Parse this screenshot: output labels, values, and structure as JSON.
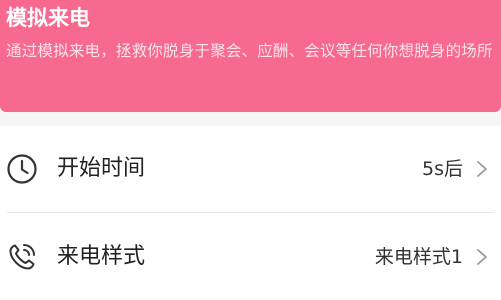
{
  "header": {
    "title": "模拟来电",
    "description": "通过模拟来电，拯救你脱身于聚会、应酬、会议等任何你想脱身的场所"
  },
  "settings": [
    {
      "label": "开始时间",
      "value": "5s后",
      "icon": "clock-icon"
    },
    {
      "label": "来电样式",
      "value": "来电样式1",
      "icon": "phone-icon"
    }
  ],
  "colors": {
    "banner": "#f7698f",
    "background": "#ffffff",
    "separator": "#f5f5f5"
  }
}
